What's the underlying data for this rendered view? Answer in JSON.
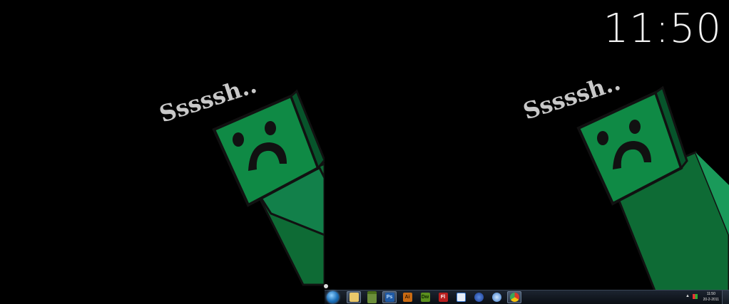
{
  "wallpaper": {
    "caption": "Sssssh..",
    "character": "creeper"
  },
  "desktop_clock": {
    "time": "11:50"
  },
  "taskbar": {
    "start_button": "start-orb-icon",
    "pinned": [
      {
        "name": "explorer",
        "label": "",
        "color": "#e9c86a"
      },
      {
        "name": "minecraft",
        "label": "",
        "color": "#6b8e3a"
      },
      {
        "name": "photoshop",
        "label": "Ps",
        "color": "#1f5aa6"
      },
      {
        "name": "illustrator",
        "label": "Ai",
        "color": "#c96a12"
      },
      {
        "name": "dreamweaver",
        "label": "Dw",
        "color": "#5b8f1e"
      },
      {
        "name": "flash",
        "label": "Fl",
        "color": "#b81e1e"
      },
      {
        "name": "messenger",
        "label": "",
        "color": "#3a7bd5"
      },
      {
        "name": "firefox",
        "label": "",
        "color": "#2a58b8"
      },
      {
        "name": "itunes",
        "label": "",
        "color": "#6aa8e6"
      },
      {
        "name": "chrome",
        "label": "",
        "color": "#d9392a"
      }
    ],
    "tray": {
      "time": "11:50",
      "date": "20-2-2011"
    }
  }
}
